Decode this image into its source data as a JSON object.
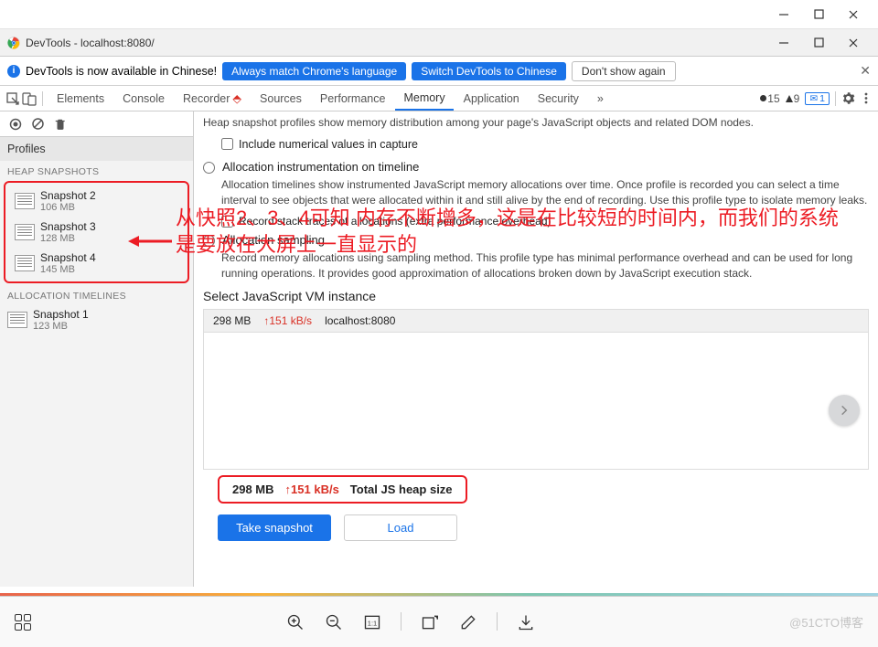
{
  "outer_window_title": " ",
  "devtools": {
    "title": "DevTools - localhost:8080/"
  },
  "lang_banner": {
    "message": "DevTools is now available in Chinese!",
    "always_match": "Always match Chrome's language",
    "switch": "Switch DevTools to Chinese",
    "dont_show": "Don't show again"
  },
  "tabs": {
    "elements": "Elements",
    "console": "Console",
    "recorder": "Recorder",
    "sources": "Sources",
    "performance": "Performance",
    "memory": "Memory",
    "application": "Application",
    "security": "Security"
  },
  "tab_status": {
    "errors": "15",
    "warnings": "9",
    "issues_icon": "✉",
    "issues": "1"
  },
  "sidebar": {
    "profiles_header": "Profiles",
    "heap_header": "HEAP SNAPSHOTS",
    "snapshots": [
      {
        "name": "Snapshot 2",
        "size": "106 MB"
      },
      {
        "name": "Snapshot 3",
        "size": "128 MB"
      },
      {
        "name": "Snapshot 4",
        "size": "145 MB"
      }
    ],
    "alloc_header": "ALLOCATION TIMELINES",
    "alloc_items": [
      {
        "name": "Snapshot 1",
        "size": "123 MB"
      }
    ]
  },
  "main": {
    "heap_desc": "Heap snapshot profiles show memory distribution among your page's JavaScript objects and related DOM nodes.",
    "include_numerical": "Include numerical values in capture",
    "alloc_title": "Allocation instrumentation on timeline",
    "alloc_desc": "Allocation timelines show instrumented JavaScript memory allocations over time. Once profile is recorded you can select a time interval to see objects that were allocated within it and still alive by the end of recording. Use this profile type to isolate memory leaks.",
    "record_stack": "Record stack traces of allocations (extra performance overhead)",
    "sampling_title": "Allocation sampling",
    "sampling_desc": "Record memory allocations using sampling method. This profile type has minimal performance overhead and can be used for long running operations. It provides good approximation of allocations broken down by JavaScript execution stack.",
    "vm_title": "Select JavaScript VM instance",
    "vm_row": {
      "mem": "298 MB",
      "rate": "↑151 kB/s",
      "host": "localhost:8080"
    },
    "heap_summary": {
      "mem": "298 MB",
      "rate": "↑151 kB/s",
      "label": "Total JS heap size"
    },
    "take_snapshot": "Take snapshot",
    "load": "Load"
  },
  "annotation": {
    "text": "从快照2、3、4可知 内存不断增多，这是在比较短的时间内，而我们的系统是要放在大屏上一直显示的"
  },
  "watermark": "@51CTO博客"
}
